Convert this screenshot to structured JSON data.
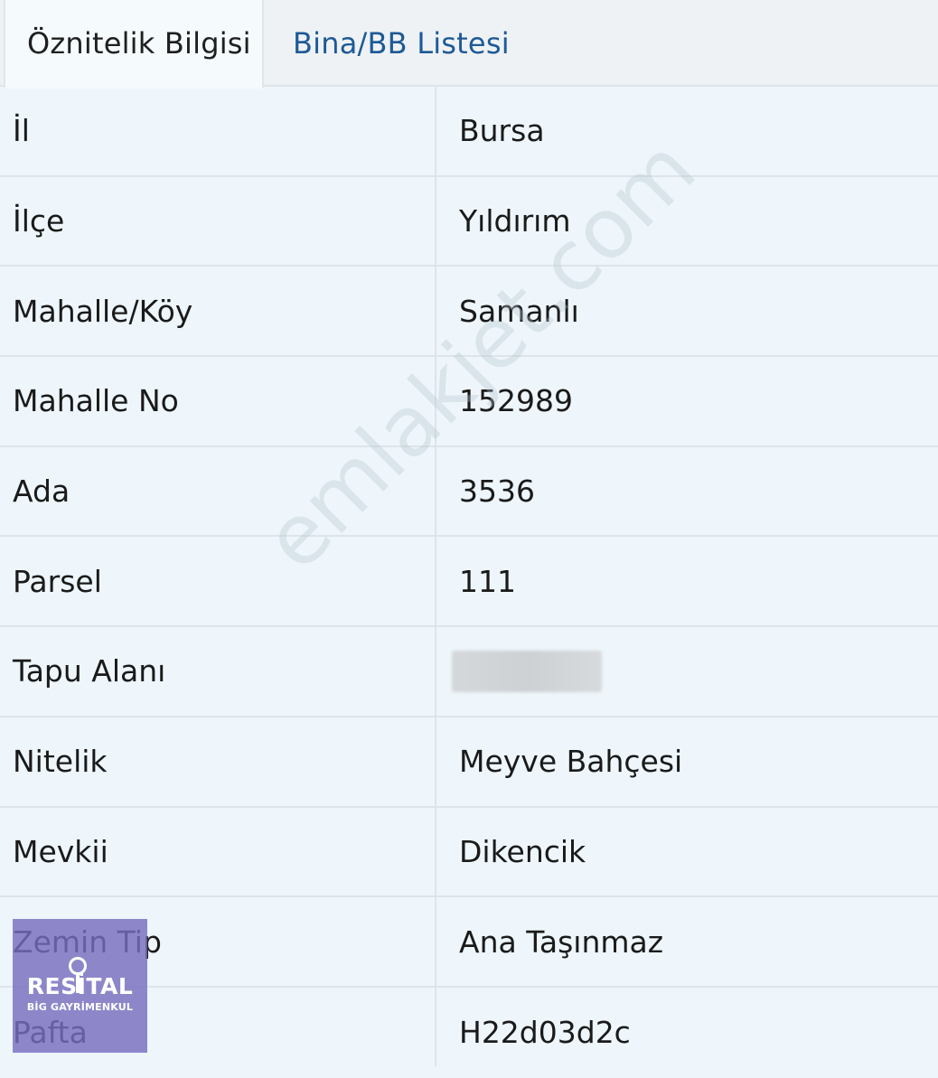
{
  "tabs": [
    {
      "label": "Öznitelik Bilgisi",
      "active": true
    },
    {
      "label": "Bina/BB Listesi",
      "active": false
    }
  ],
  "rows": [
    {
      "label": "İl",
      "value": "Bursa"
    },
    {
      "label": "İlçe",
      "value": "Yıldırım"
    },
    {
      "label": "Mahalle/Köy",
      "value": "Samanlı"
    },
    {
      "label": "Mahalle No",
      "value": "152989"
    },
    {
      "label": "Ada",
      "value": "3536"
    },
    {
      "label": "Parsel",
      "value": "111"
    },
    {
      "label": "Tapu Alanı",
      "value": ""
    },
    {
      "label": "Nitelik",
      "value": "Meyve Bahçesi"
    },
    {
      "label": "Mevkii",
      "value": "Dikencik"
    },
    {
      "label": "Zemin Tip",
      "value": "Ana Taşınmaz"
    },
    {
      "label": "Pafta",
      "value": "H22d03d2c"
    }
  ],
  "watermark": "emlakjet.com",
  "logo": {
    "name": "RESİTAL",
    "subtitle": "BİG GAYRİMENKUL",
    "color": "#786ebe"
  },
  "colors": {
    "background": "#eef6fb",
    "tab_link": "#1e5a96",
    "border": "#dde5ea"
  }
}
